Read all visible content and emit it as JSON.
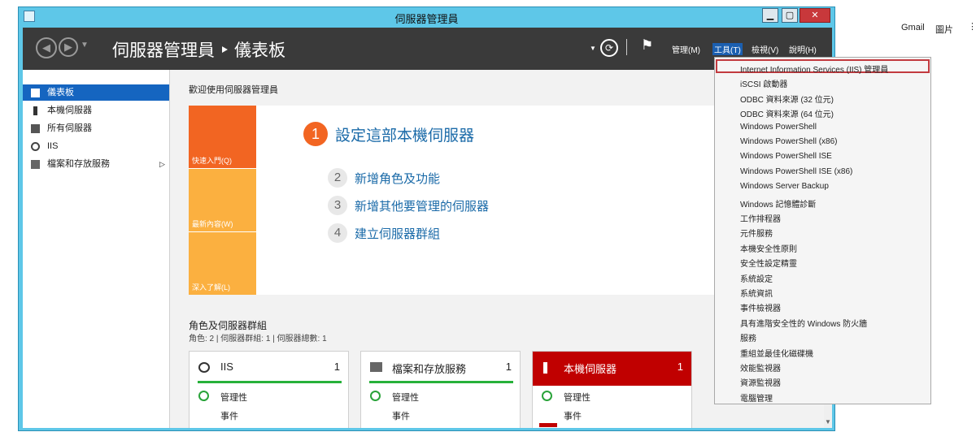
{
  "window": {
    "title": "伺服器管理員",
    "min": "▁",
    "max": "▢",
    "close": "✕"
  },
  "header": {
    "breadcrumb": "伺服器管理員 ‣ 儀表板",
    "menus": [
      "管理(M)",
      "工具(T)",
      "檢視(V)",
      "說明(H)"
    ],
    "active_menu": "工具(T)"
  },
  "browser": {
    "gmail": "Gmail",
    "images": "圖片"
  },
  "sidebar": {
    "items": [
      {
        "label": "儀表板",
        "icon": "dashboard-icon",
        "active": true
      },
      {
        "label": "本機伺服器",
        "icon": "server-icon"
      },
      {
        "label": "所有伺服器",
        "icon": "servers-icon"
      },
      {
        "label": "IIS",
        "icon": "iis-icon"
      },
      {
        "label": "檔案和存放服務",
        "icon": "file-storage-icon",
        "arrow": "▷"
      }
    ]
  },
  "main": {
    "welcome": "歡迎使用伺服器管理員",
    "tiles": [
      "快速入門(Q)",
      "最新內容(W)",
      "深入了解(L)"
    ],
    "steps": [
      {
        "num": "1",
        "text": "設定這部本機伺服器"
      },
      {
        "num": "2",
        "text": "新增角色及功能"
      },
      {
        "num": "3",
        "text": "新增其他要管理的伺服器"
      },
      {
        "num": "4",
        "text": "建立伺服器群組"
      }
    ],
    "roles_title": "角色及伺服器群組",
    "roles_sub": "角色: 2 | 伺服器群組: 1 | 伺服器總數: 1",
    "cards": [
      {
        "title": "IIS",
        "count": "1",
        "row1": "管理性",
        "row2": "事件"
      },
      {
        "title": "檔案和存放服務",
        "count": "1",
        "row1": "管理性",
        "row2": "事件"
      },
      {
        "title": "本機伺服器",
        "count": "1",
        "row1": "管理性",
        "row2": "事件"
      }
    ]
  },
  "tools_menu": [
    "Internet Information Services (IIS) 管理員",
    "iSCSI 啟動器",
    "ODBC 資料來源 (32 位元)",
    "ODBC 資料來源 (64 位元)",
    "Windows PowerShell",
    "Windows PowerShell (x86)",
    "Windows PowerShell ISE",
    "Windows PowerShell ISE (x86)",
    "Windows Server Backup",
    "Windows 記憶體診斷",
    "工作排程器",
    "元件服務",
    "本機安全性原則",
    "安全性設定精靈",
    "系統設定",
    "系統資訊",
    "事件檢視器",
    "具有進階安全性的 Windows 防火牆",
    "服務",
    "重組並最佳化磁碟機",
    "效能監視器",
    "資源監視器",
    "電腦管理"
  ],
  "colors": {
    "accent": "#1565c0",
    "tile_dark": "#f26522",
    "tile_light": "#fbb040",
    "red_card": "#c00000",
    "ok": "#27b13a"
  }
}
